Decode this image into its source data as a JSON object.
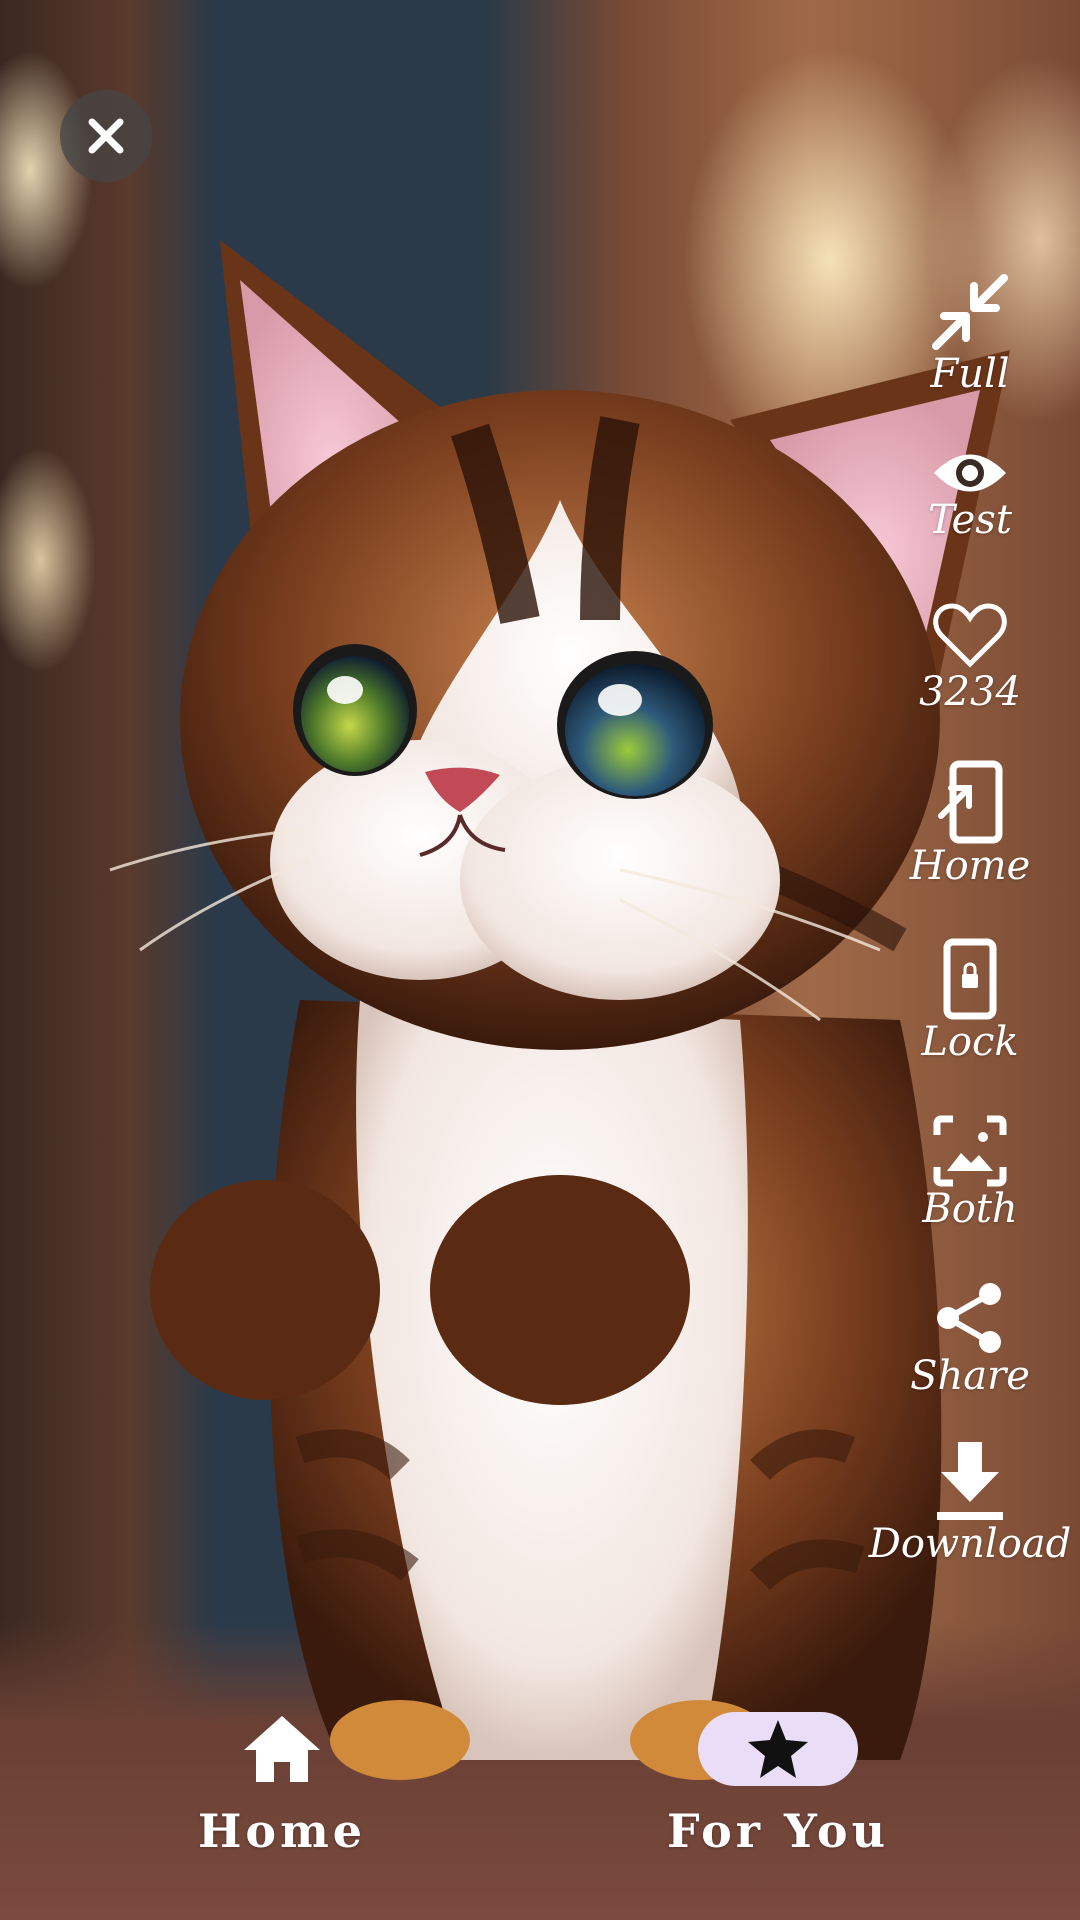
{
  "wallpaper": {
    "subject": "kitten-illustration"
  },
  "close_button": {
    "icon": "close-icon"
  },
  "actions": [
    {
      "id": "full",
      "label": "Full",
      "icon": "collapse-arrows-icon"
    },
    {
      "id": "test",
      "label": "Test",
      "icon": "eye-icon"
    },
    {
      "id": "like",
      "label": "3234",
      "icon": "heart-outline-icon"
    },
    {
      "id": "home",
      "label": "Home",
      "icon": "set-home-screen-icon"
    },
    {
      "id": "lock",
      "label": "Lock",
      "icon": "lock-screen-icon"
    },
    {
      "id": "both",
      "label": "Both",
      "icon": "image-frame-icon"
    },
    {
      "id": "share",
      "label": "Share",
      "icon": "share-icon"
    },
    {
      "id": "download",
      "label": "Download",
      "icon": "download-icon"
    }
  ],
  "bottom_nav": {
    "items": [
      {
        "label": "Home",
        "icon": "home-icon",
        "active": false
      },
      {
        "label": "For You",
        "icon": "star-icon",
        "active": true
      }
    ],
    "active_pill_color": "#e9ddf7"
  }
}
